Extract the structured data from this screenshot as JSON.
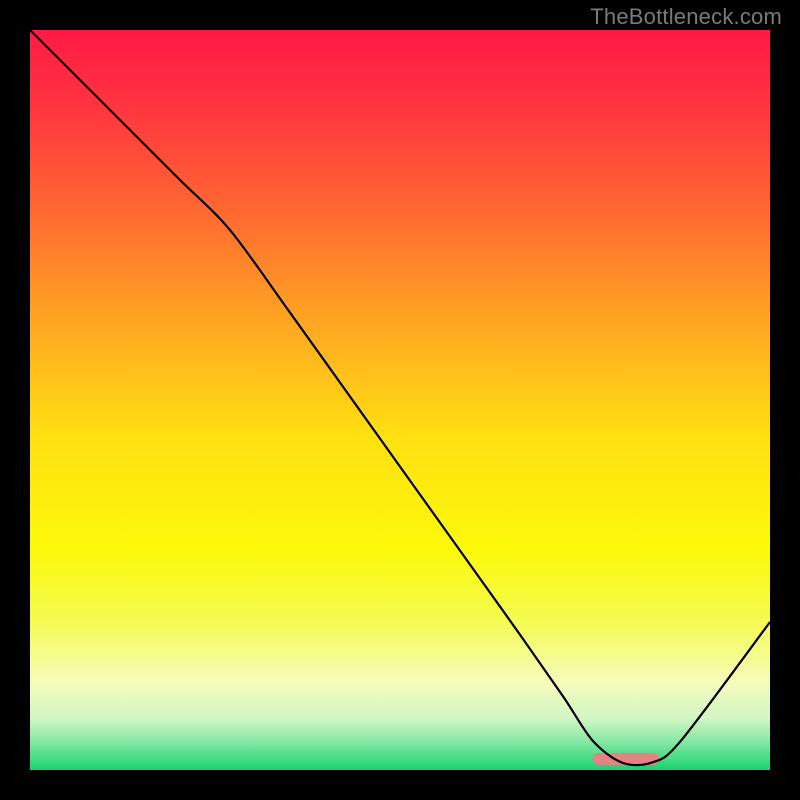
{
  "watermark": "TheBottleneck.com",
  "chart_data": {
    "type": "line",
    "title": "",
    "xlabel": "",
    "ylabel": "",
    "xlim": [
      0,
      100
    ],
    "ylim": [
      0,
      100
    ],
    "grid": false,
    "legend": false,
    "gradient_stops": [
      {
        "offset": 0.0,
        "color": "#ff1a44"
      },
      {
        "offset": 0.1,
        "color": "#ff3340"
      },
      {
        "offset": 0.25,
        "color": "#ff6a30"
      },
      {
        "offset": 0.4,
        "color": "#ffa821"
      },
      {
        "offset": 0.55,
        "color": "#ffe012"
      },
      {
        "offset": 0.7,
        "color": "#fcf90a"
      },
      {
        "offset": 0.8,
        "color": "#f4fb53"
      },
      {
        "offset": 0.88,
        "color": "#f6fcbb"
      },
      {
        "offset": 0.93,
        "color": "#d2f6c4"
      },
      {
        "offset": 0.965,
        "color": "#7de7a1"
      },
      {
        "offset": 1.0,
        "color": "#18d36e"
      }
    ],
    "series": [
      {
        "name": "curve",
        "stroke": "#000000",
        "stroke_width": 2.2,
        "x": [
          0,
          10,
          20,
          27,
          35,
          45,
          55,
          65,
          72,
          76,
          80,
          84,
          88,
          100
        ],
        "y": [
          100,
          90,
          80,
          73,
          62,
          48,
          34,
          20,
          10,
          4,
          1,
          1,
          4,
          20
        ]
      }
    ],
    "marker_bar": {
      "x0": 76,
      "x1": 85,
      "y": 1.5,
      "color": "#e58384",
      "radius": 3
    }
  }
}
